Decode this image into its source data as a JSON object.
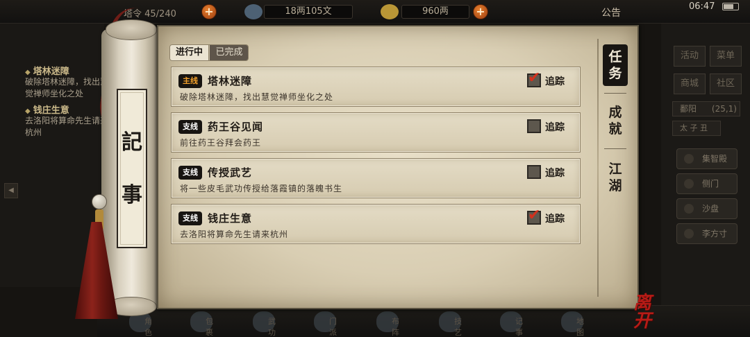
{
  "topbar": {
    "stamina_text": "塔令 45/240",
    "copper_text": "18两105文",
    "silver_text": "960两",
    "notice_label": "公告",
    "clock": "06:47",
    "plus_label": "+"
  },
  "left_tracker": {
    "quests": [
      {
        "marker": "◆",
        "title": "塔林迷障",
        "desc": "破除塔林迷障，找出慧觉禅师坐化之处"
      },
      {
        "marker": "◆",
        "title": "钱庄生意",
        "desc": "去洛阳将算命先生请来杭州"
      }
    ],
    "arrow": "◀"
  },
  "right_menu": {
    "buttons": [
      "活动",
      "菜单",
      "商城",
      "社区"
    ],
    "location": "鄱阳",
    "coords": "(25,1)",
    "time_bar": "太 子 丑",
    "list": [
      "集智殿",
      "侧门",
      "沙盘",
      "李方寸"
    ]
  },
  "bottombar": {
    "items": [
      "角色",
      "包裹",
      "武功",
      "门派",
      "布阵",
      "技艺",
      "记事",
      "地图"
    ]
  },
  "scroll": {
    "label_1": "記",
    "label_2": "事"
  },
  "panel": {
    "tab_active": "进行中",
    "tab_inactive": "已完成",
    "quests": [
      {
        "type": "主线",
        "type_kind": "main",
        "title": "塔林迷障",
        "desc": "破除塔林迷障，找出慧觉禅师坐化之处",
        "track_label": "追踪",
        "tracked": true
      },
      {
        "type": "支线",
        "type_kind": "side",
        "title": "药王谷见闻",
        "desc": "前往药王谷拜会药王",
        "track_label": "追踪",
        "tracked": false
      },
      {
        "type": "支线",
        "type_kind": "side",
        "title": "传授武艺",
        "desc": "将一些皮毛武功传授给落霞镇的落魄书生",
        "track_label": "追踪",
        "tracked": false
      },
      {
        "type": "支线",
        "type_kind": "side",
        "title": "钱庄生意",
        "desc": "去洛阳将算命先生请来杭州",
        "track_label": "追踪",
        "tracked": true
      }
    ],
    "side_tabs": [
      {
        "label": "任\n务",
        "active": true
      },
      {
        "label": "成\n就",
        "active": false
      },
      {
        "label": "江\n湖",
        "active": false
      }
    ],
    "check_glyph": "✔"
  },
  "leave_label": "离开",
  "colors": {
    "parchment": "#d9ceb3",
    "main_badge_text": "#f2a02b",
    "check_red": "#d2311d",
    "leave_red": "#b61b16"
  }
}
